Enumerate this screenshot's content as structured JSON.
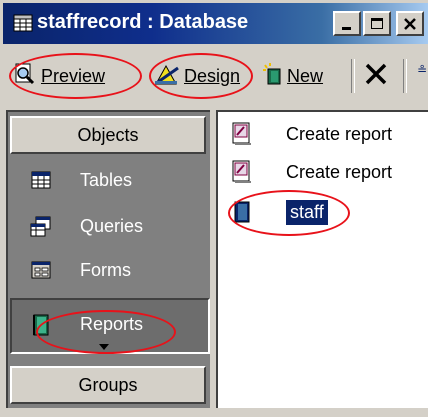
{
  "window": {
    "title": "staffrecord : Database",
    "controls": [
      "minimize-button",
      "maximize-button",
      "close-button"
    ]
  },
  "toolbar": {
    "preview_label": "Preview",
    "preview_accel": "P",
    "design_label": "Design",
    "design_accel": "D",
    "new_label": "New",
    "new_accel": "N",
    "extra_label": "≗"
  },
  "sidebar": {
    "objects_label": "Objects",
    "groups_label": "Groups",
    "items": [
      {
        "label": "Tables",
        "icon": "table-icon"
      },
      {
        "label": "Queries",
        "icon": "query-icon"
      },
      {
        "label": "Forms",
        "icon": "form-icon"
      },
      {
        "label": "Reports",
        "icon": "report-icon",
        "selected": true
      }
    ]
  },
  "list": {
    "items": [
      {
        "label": "Create report",
        "icon": "wizard-report-icon"
      },
      {
        "label": "Create report",
        "icon": "wizard-report-icon"
      },
      {
        "label": "staff",
        "icon": "report-icon",
        "selected": true
      }
    ]
  },
  "colors": {
    "titlebar_start": "#0a246a",
    "titlebar_end": "#a6caf0",
    "highlight_circle": "#e8121a",
    "selection": "#0a246a",
    "panel_gray": "#808080"
  }
}
